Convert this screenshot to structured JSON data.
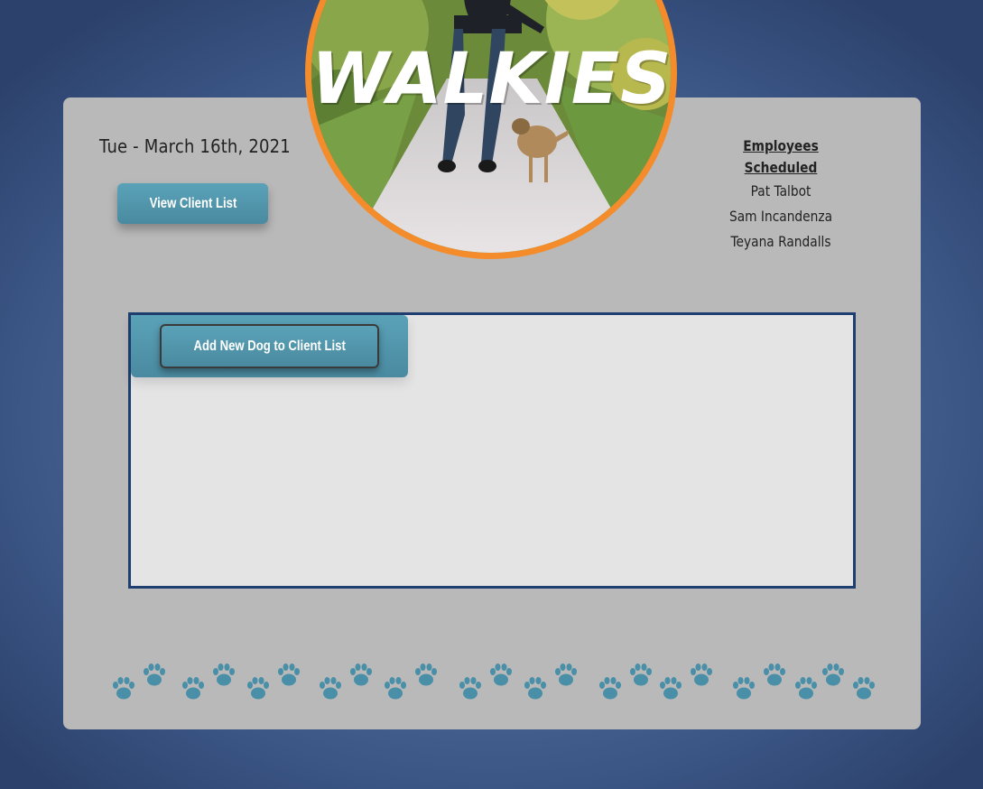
{
  "header": {
    "date": "Tue - March 16th, 2021",
    "logo_text": "WALKIES"
  },
  "actions": {
    "view_client_list_label": "View Client List",
    "add_dog_label": "Add New Dog to Client List"
  },
  "employees": {
    "title": "Employees Scheduled",
    "names": [
      "Pat Talbot",
      "Sam Incandenza",
      "Teyana Randalls"
    ]
  },
  "colors": {
    "page_bg": "#4d6999",
    "card_bg": "#b9b9b9",
    "accent_teal": "#4f93aa",
    "logo_ring": "#f58c2c",
    "panel_border": "#1f3f70",
    "paw": "#4a8fa8"
  },
  "decor": {
    "paw_icon": "paw-print-icon"
  }
}
